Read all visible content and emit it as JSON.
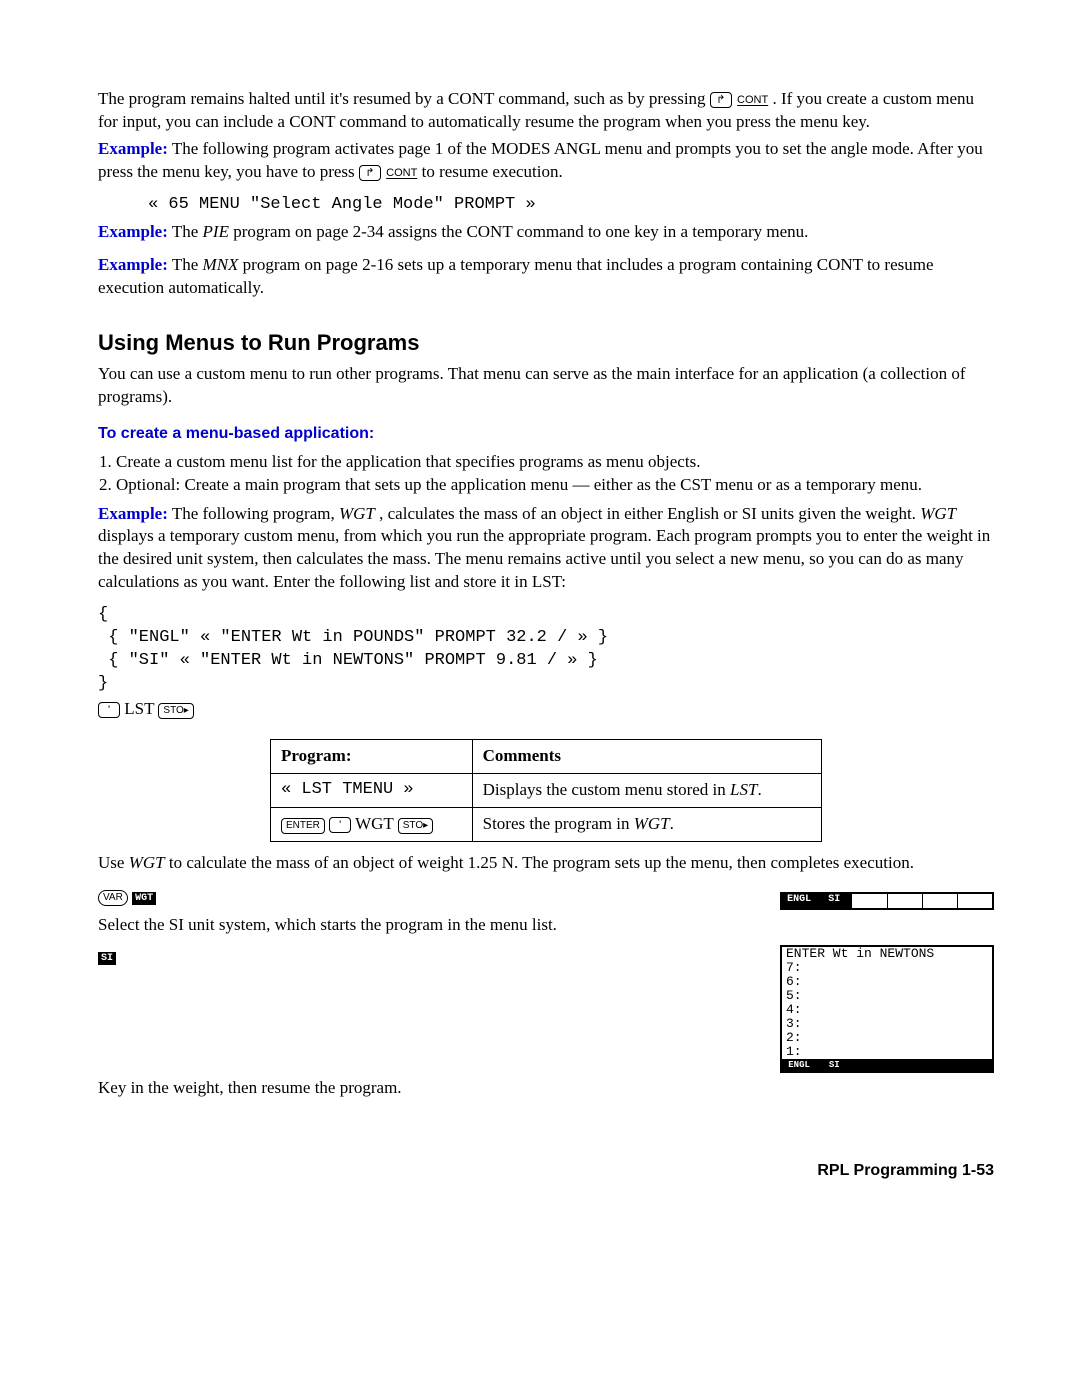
{
  "p1": {
    "a": "The program remains halted until it's resumed by a CONT command, such as by pressing ",
    "b": " . If you create a custom menu for input, you can include a CONT command to automatically resume the program when you press the menu key."
  },
  "key_cont": "CONT",
  "ex1": {
    "label": "Example:",
    "a": " The following program activates page 1 of the MODES ANGL menu and prompts you to set the angle mode. After you press the menu key, you have to press ",
    "b": " to resume execution."
  },
  "code1": "« 65 MENU \"Select Angle Mode\" PROMPT »",
  "ex2": {
    "label": "Example:",
    "a": " The ",
    "name": "PIE",
    "b": " program on page 2-34 assigns the CONT command to one key in a temporary menu."
  },
  "ex3": {
    "label": "Example:",
    "a": " The ",
    "name": "MNX",
    "b": " program on page 2-16 sets up a temporary menu that includes a program containing CONT to resume execution automatically."
  },
  "h2": "Using Menus to Run Programs",
  "p2": "You can use a custom menu to run other programs. That menu can serve as the main interface for an application (a collection of programs).",
  "sub": "To create a menu-based application:",
  "li1": "Create a custom menu list for the application that specifies programs as menu objects.",
  "li2": "Optional: Create a main program that sets up the application menu — either as the CST menu or as a temporary menu.",
  "ex4": {
    "label": "Example:",
    "a": " The following program, ",
    "name": "WGT",
    "b": ", calculates the mass of an object in either English or SI units given the weight. ",
    "c": " displays a temporary custom menu, from which you run the appropriate program. Each program prompts you to enter the weight in the desired unit system, then calculates the mass. The menu remains active until you select a new menu, so you can do as many calculations as you want. Enter the following list and store it in LST:"
  },
  "codeblock": "{\n { \"ENGL\" « \"ENTER Wt in POUNDS\" PROMPT 32.2 / » }\n { \"SI\" « \"ENTER Wt in NEWTONS\" PROMPT 9.81 / » }\n}",
  "store_lst": " LST ",
  "key_sto": "STO▸",
  "table": {
    "h1": "Program:",
    "h2": "Comments",
    "r1c1": "« LST TMENU »",
    "r1c2a": "Displays the custom menu stored in ",
    "r1c2b": "LST",
    "r1c2c": ".",
    "r2a_enter": "ENTER",
    "r2a_mid": " WGT ",
    "r2c2a": "Stores the program in ",
    "r2c2b": "WGT",
    "r2c2c": "."
  },
  "p_use": {
    "a": "Use ",
    "name": "WGT",
    "b": " to calculate the mass of an object of weight 1.25 N. The program sets up the menu, then completes execution."
  },
  "key_var": "VAR",
  "mk_wgt": "WGT",
  "softkeys1": {
    "k1": "ENGL",
    "k2": "SI"
  },
  "p_select": "Select the SI unit system, which starts the program in the menu list.",
  "mk_si": "SI",
  "screen": {
    "title": "ENTER Wt in NEWTONS",
    "l7": "7:",
    "l6": "6:",
    "l5": "5:",
    "l4": "4:",
    "l3": "3:",
    "l2": "2:",
    "l1": "1:",
    "k1": "ENGL",
    "k2": "SI"
  },
  "p_keyin": "Key in the weight, then resume the program.",
  "footer": "RPL Programming   1-53"
}
